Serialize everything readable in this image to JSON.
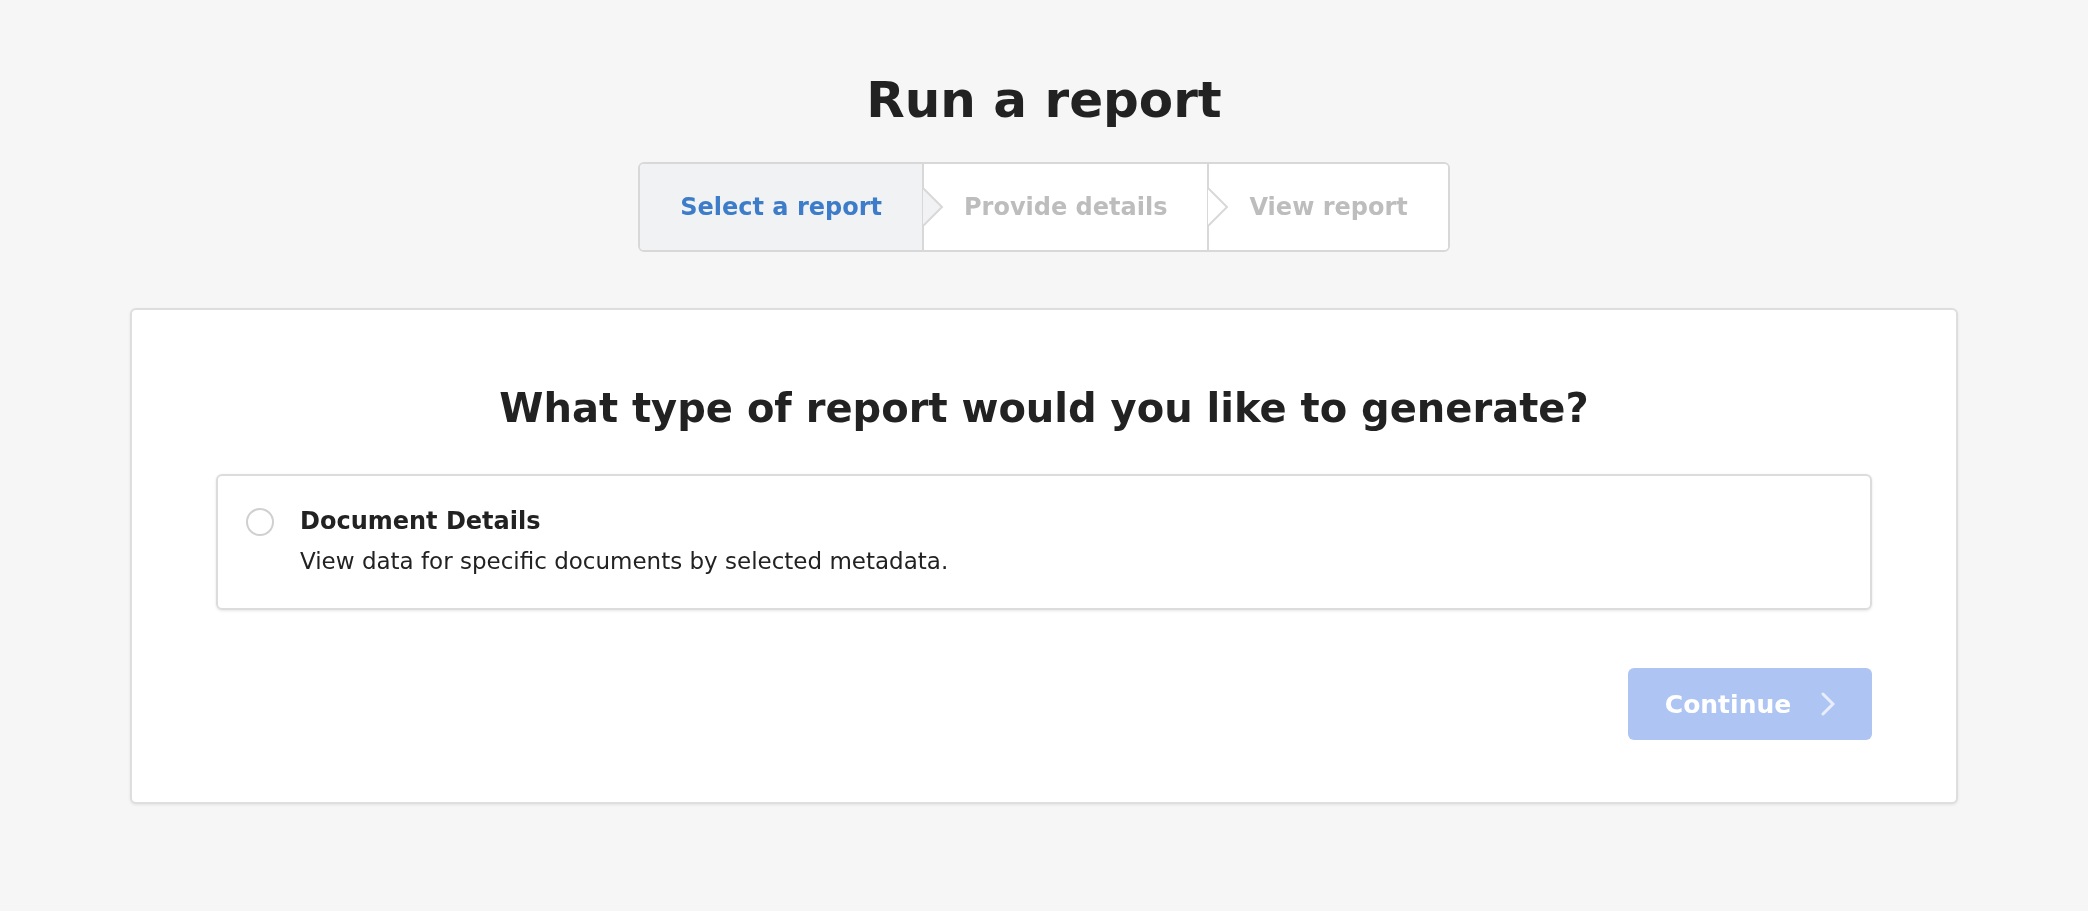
{
  "title": "Run a report",
  "steps": [
    {
      "label": "Select a report",
      "selected": true
    },
    {
      "label": "Provide details",
      "selected": false
    },
    {
      "label": "View report",
      "selected": false
    }
  ],
  "question": "What type of report would you like to generate?",
  "options": [
    {
      "title": "Document Details",
      "description": "View data for specific documents by selected metadata.",
      "selected": false
    }
  ],
  "continue_button": {
    "label": "Continue",
    "disabled": true
  }
}
